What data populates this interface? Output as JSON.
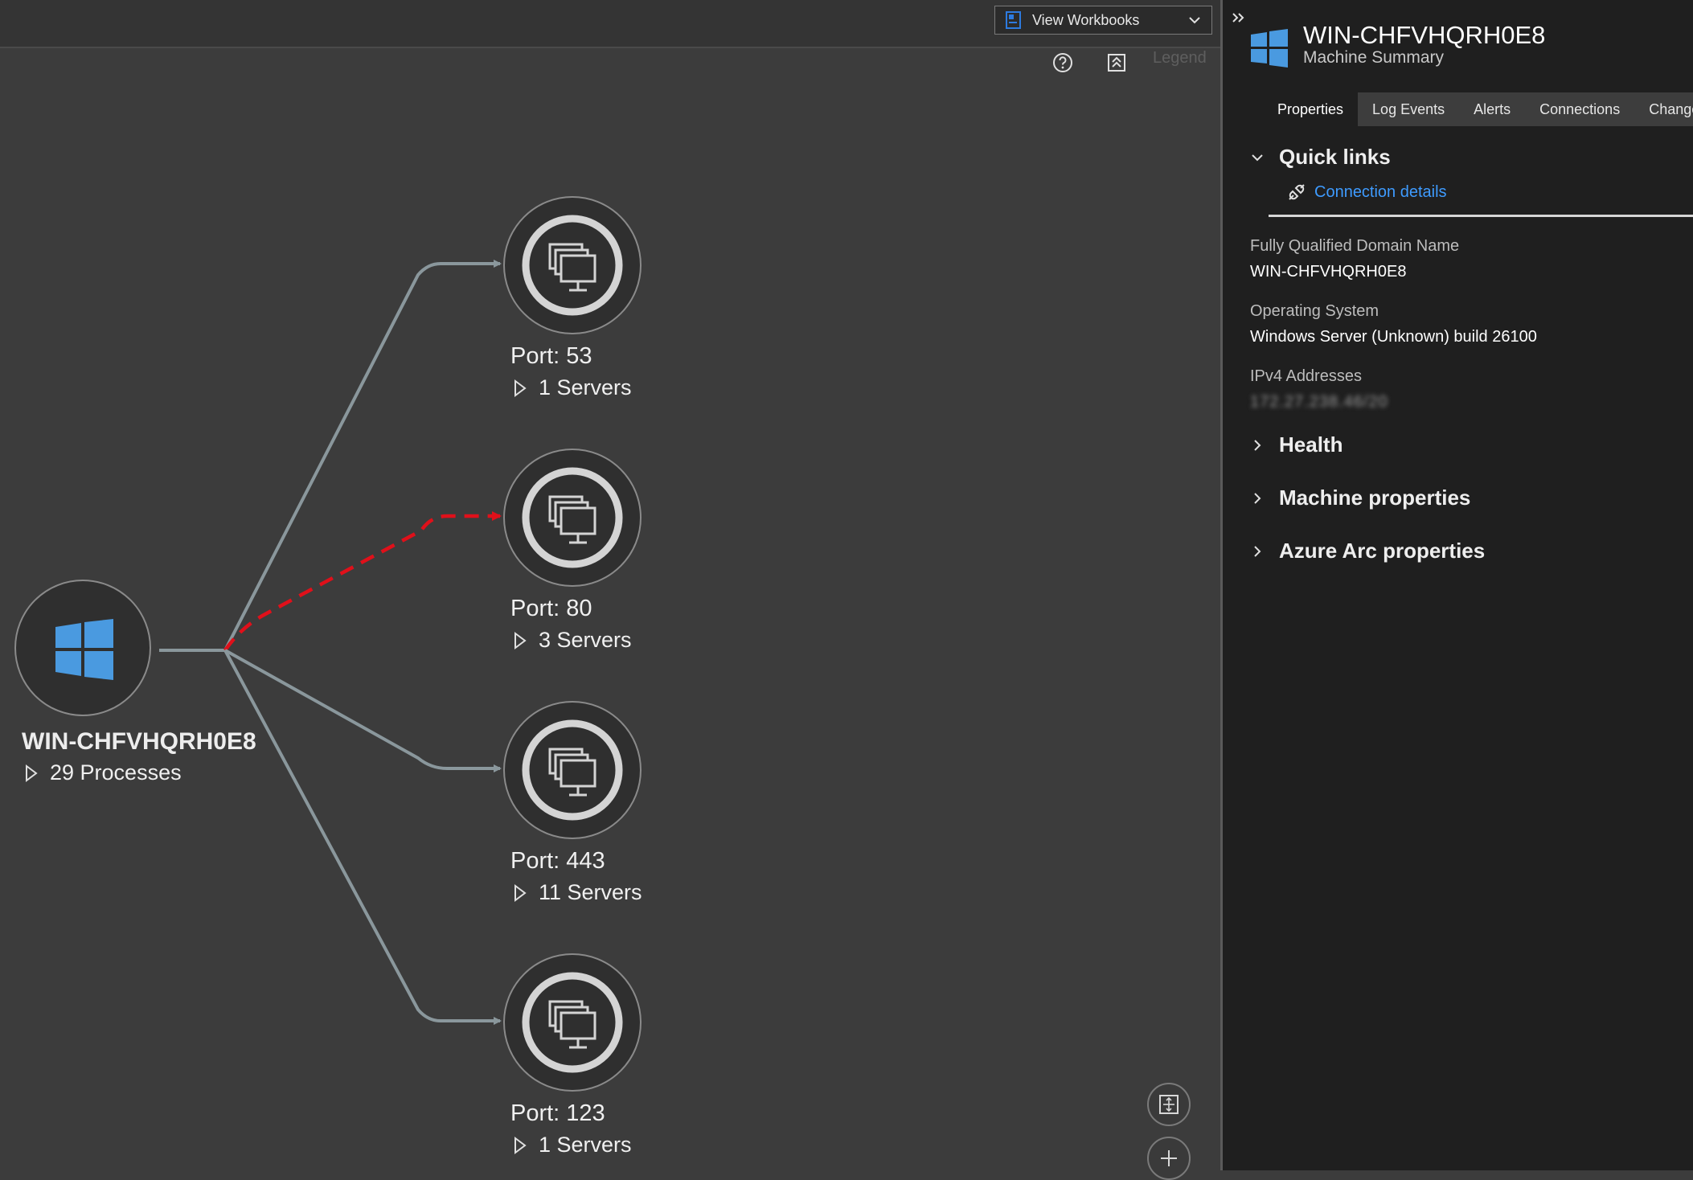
{
  "toolbar": {
    "workbooks_label": "View Workbooks",
    "legend_label": "Legend"
  },
  "map": {
    "root": {
      "title": "WIN-CHFVHQRH0E8",
      "processes": "29 Processes"
    },
    "ports": [
      {
        "port": "Port: 53",
        "servers": "1 Servers"
      },
      {
        "port": "Port: 80",
        "servers": "3 Servers"
      },
      {
        "port": "Port: 443",
        "servers": "11 Servers"
      },
      {
        "port": "Port: 123",
        "servers": "1 Servers"
      }
    ]
  },
  "panel": {
    "title": "WIN-CHFVHQRH0E8",
    "subtitle": "Machine Summary",
    "tabs": [
      "Properties",
      "Log Events",
      "Alerts",
      "Connections",
      "Changes"
    ],
    "quick_links": {
      "heading": "Quick links",
      "link": "Connection details"
    },
    "properties": {
      "fqdn_label": "Fully Qualified Domain Name",
      "fqdn_value": "WIN-CHFVHQRH0E8",
      "os_label": "Operating System",
      "os_value": "Windows Server (Unknown) build 26100",
      "ipv4_label": "IPv4 Addresses",
      "ipv4_value": "172.27.238.46/20"
    },
    "sections": [
      "Health",
      "Machine properties",
      "Azure Arc properties"
    ]
  },
  "colors": {
    "edge_normal": "#8a979c",
    "edge_alert": "#e0101a",
    "windows_blue": "#4a9ae0",
    "link_blue": "#3e9bff"
  }
}
